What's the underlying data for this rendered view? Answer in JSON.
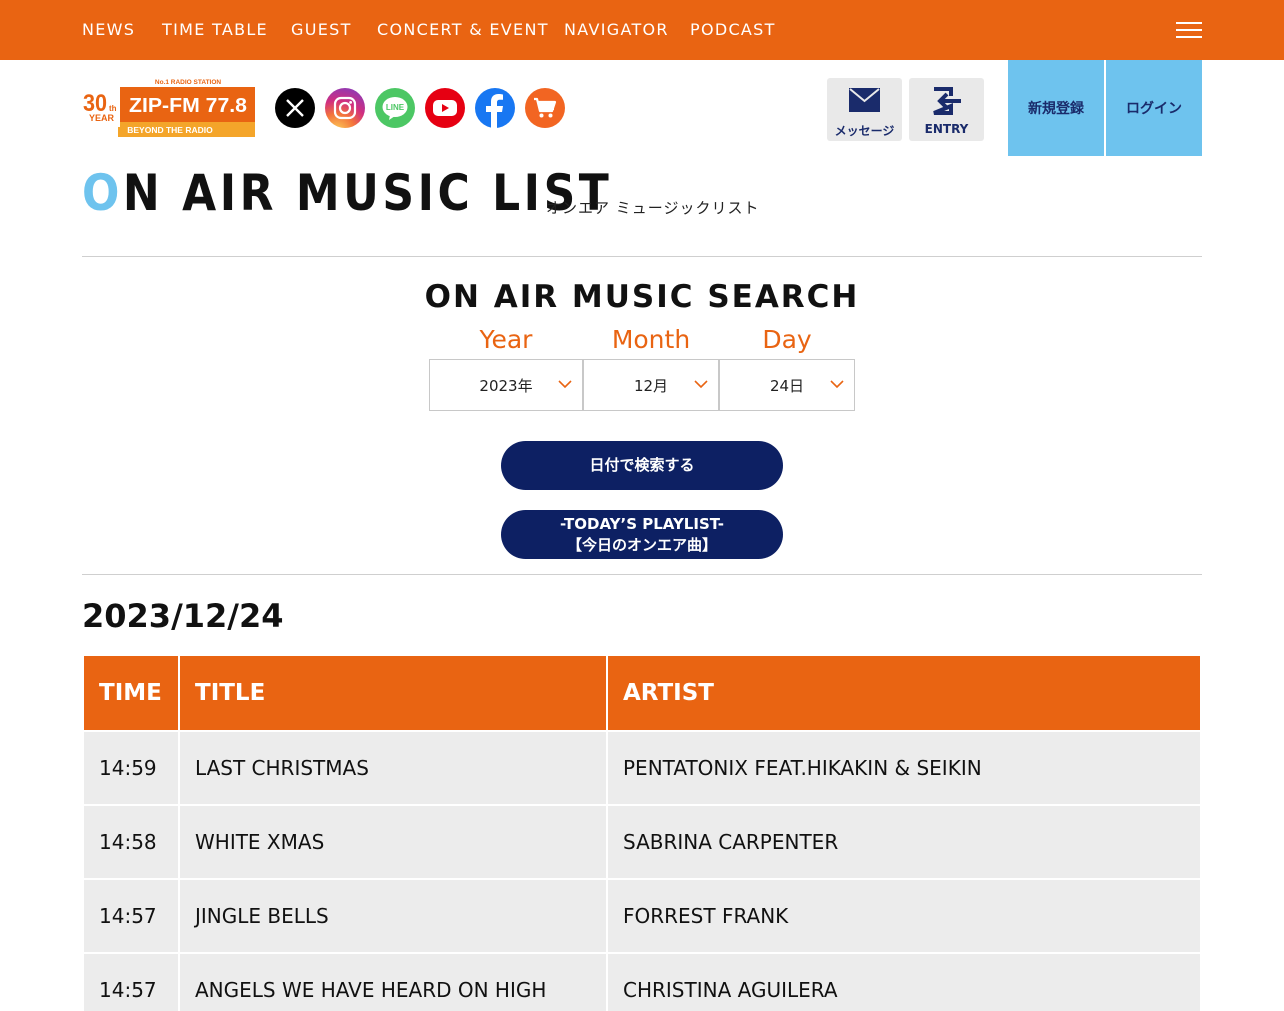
{
  "nav": {
    "items": [
      "NEWS",
      "TIME TABLE",
      "GUEST",
      "CONCERT & EVENT",
      "NAVIGATOR",
      "PODCAST"
    ]
  },
  "logo": {
    "badge_top": "30",
    "badge_th": "th",
    "badge_year": "YEAR",
    "tagline_top": "No.1 RADIO STATION",
    "name": "ZIP-FM 77.8",
    "tagline_bottom": "BEYOND THE RADIO"
  },
  "social": {
    "icons": [
      "x-icon",
      "instagram-icon",
      "line-icon",
      "youtube-icon",
      "facebook-icon",
      "cart-icon"
    ],
    "line_text": "LINE"
  },
  "header_actions": {
    "message_label": "メッセージ",
    "entry_label": "ENTRY",
    "register_label": "新規登録",
    "login_label": "ログイン"
  },
  "page": {
    "title_first": "O",
    "title_rest": "N AIR MUSIC LIST",
    "subtitle": "オンエア ミュージックリスト"
  },
  "search": {
    "heading": "ON AIR MUSIC SEARCH",
    "year_label": "Year",
    "month_label": "Month",
    "day_label": "Day",
    "year_value": "2023年",
    "month_value": "12月",
    "day_value": "24日",
    "search_button": "日付で検索する",
    "today_line1": "-TODAY’S PLAYLIST-",
    "today_line2": "【今日のオンエア曲】"
  },
  "playlist": {
    "date": "2023/12/24",
    "columns": [
      "TIME",
      "TITLE",
      "ARTIST"
    ],
    "rows": [
      {
        "time": "14:59",
        "title": "LAST CHRISTMAS",
        "artist": "PENTATONIX FEAT.HIKAKIN & SEIKIN"
      },
      {
        "time": "14:58",
        "title": "WHITE XMAS",
        "artist": "SABRINA CARPENTER"
      },
      {
        "time": "14:57",
        "title": "JINGLE BELLS",
        "artist": "FORREST FRANK"
      },
      {
        "time": "14:57",
        "title": "ANGELS WE HAVE HEARD ON HIGH",
        "artist": "CHRISTINA AGUILERA"
      }
    ]
  },
  "colors": {
    "brand_orange": "#e96412",
    "navy": "#0d2063",
    "sky": "#6ec3ee"
  }
}
